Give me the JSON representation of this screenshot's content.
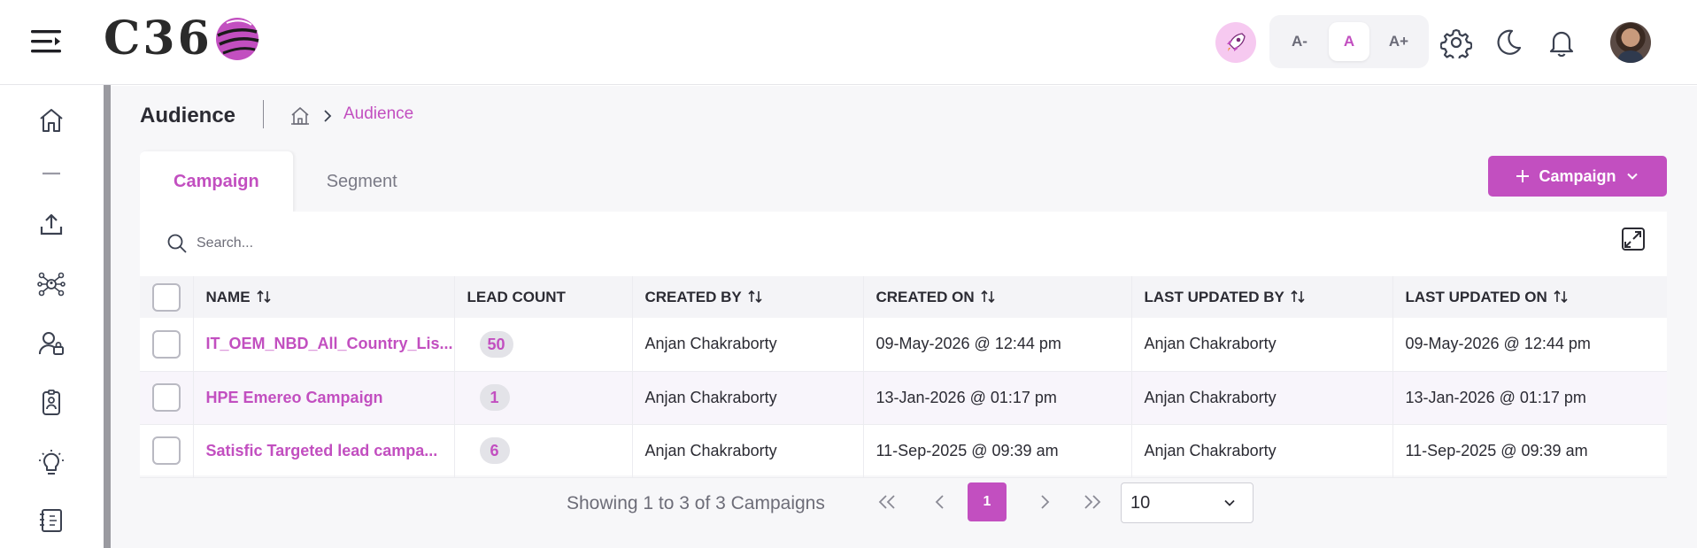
{
  "header": {
    "logo_text": "C36",
    "font_controls": [
      {
        "label": "A-",
        "active": false
      },
      {
        "label": "A",
        "active": true
      },
      {
        "label": "A+",
        "active": false
      }
    ],
    "icons": [
      "rocket-icon",
      "gear-icon",
      "moon-icon",
      "bell-icon"
    ]
  },
  "sidebar": {
    "items": [
      "home-icon",
      "dash-icon",
      "upload-icon",
      "network-icon",
      "users-icon",
      "contact-card-icon",
      "lightbulb-icon",
      "book-icon"
    ]
  },
  "page": {
    "title": "Audience",
    "breadcrumb_current": "Audience"
  },
  "tabs": [
    {
      "label": "Campaign",
      "active": true
    },
    {
      "label": "Segment",
      "active": false
    }
  ],
  "add_button": {
    "label": "Campaign"
  },
  "search": {
    "placeholder": "Search..."
  },
  "table": {
    "columns": [
      "NAME",
      "LEAD COUNT",
      "CREATED BY",
      "CREATED ON",
      "LAST UPDATED BY",
      "LAST UPDATED ON"
    ],
    "rows": [
      {
        "name": "IT_OEM_NBD_All_Country_Lis...",
        "lead_count": "50",
        "created_by": "Anjan Chakraborty",
        "created_on": "09-May-2026 @ 12:44 pm",
        "last_updated_by": "Anjan Chakraborty",
        "last_updated_on": "09-May-2026 @ 12:44 pm"
      },
      {
        "name": "HPE Emereo Campaign",
        "lead_count": "1",
        "created_by": "Anjan Chakraborty",
        "created_on": "13-Jan-2026 @ 01:17 pm",
        "last_updated_by": "Anjan Chakraborty",
        "last_updated_on": "13-Jan-2026 @ 01:17 pm"
      },
      {
        "name": "Satisfic Targeted lead campa...",
        "lead_count": "6",
        "created_by": "Anjan Chakraborty",
        "created_on": "11-Sep-2025 @ 09:39 am",
        "last_updated_by": "Anjan Chakraborty",
        "last_updated_on": "11-Sep-2025 @ 09:39 am"
      }
    ]
  },
  "pagination": {
    "showing_text": "Showing 1 to 3 of 3 Campaigns",
    "current_page": "1",
    "per_page": "10"
  },
  "colors": {
    "accent": "#c24fc0",
    "badge_bg": "#e3e3e8",
    "rocket_bg": "#f6c9f0"
  }
}
